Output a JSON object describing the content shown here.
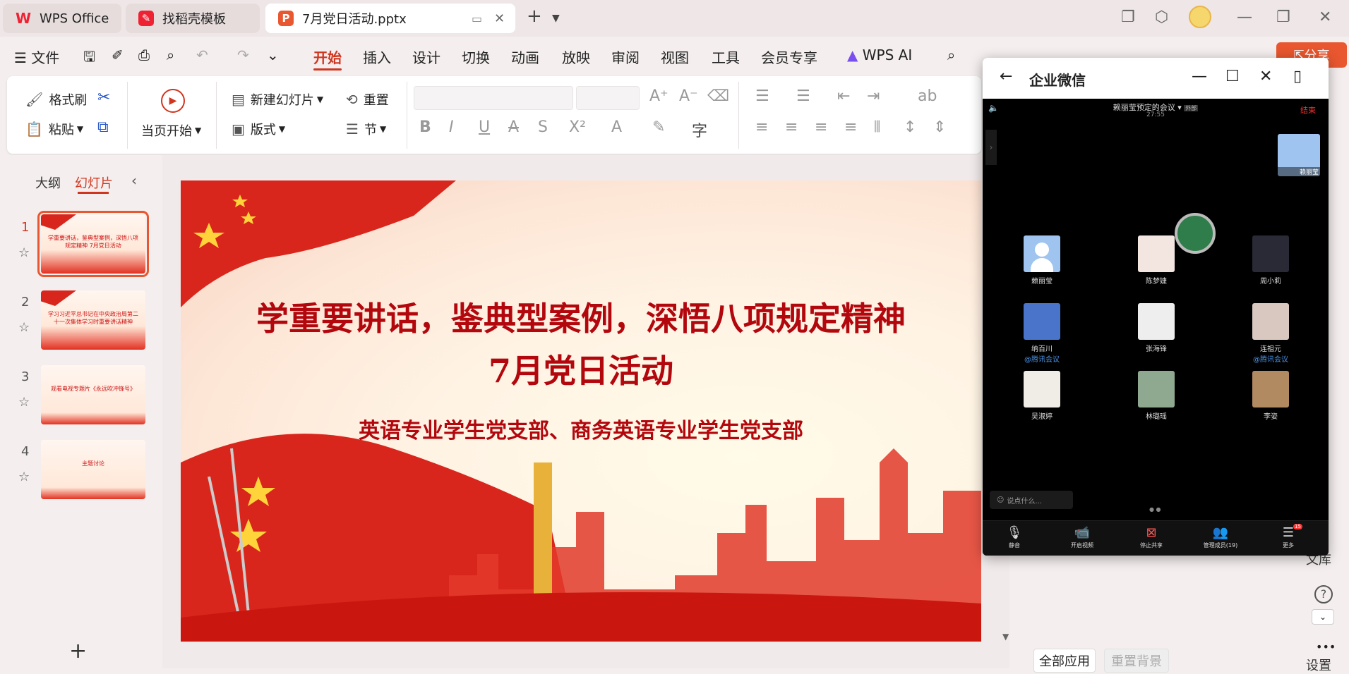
{
  "tabs": [
    {
      "label": "WPS Office",
      "icon": "wps-logo-icon"
    },
    {
      "label": "找稻壳模板",
      "icon": "docer-icon"
    },
    {
      "label": "7月党日活动.pptx",
      "icon": "ppt-file-icon"
    }
  ],
  "menu": {
    "file": "文件",
    "items": [
      "开始",
      "插入",
      "设计",
      "切换",
      "动画",
      "放映",
      "审阅",
      "视图",
      "工具",
      "会员专享"
    ],
    "wps_ai": "WPS AI",
    "share": "分享"
  },
  "ribbon": {
    "format_painter": "格式刷",
    "paste": "粘贴",
    "start_current": "当页开始",
    "new_slide": "新建幻灯片",
    "layout": "版式",
    "reset": "重置",
    "section": "节"
  },
  "sidebar": {
    "tab_outline": "大纲",
    "tab_slides": "幻灯片",
    "slides": [
      {
        "num": "1",
        "text": "学重要讲话，鉴典型案例，深悟八项规定精神 7月党日活动"
      },
      {
        "num": "2",
        "text": "学习习近平总书记在中央政治局第二十一次集体学习时重要讲话精神"
      },
      {
        "num": "3",
        "text": "观看电视专题片《永远吹冲锋号》"
      },
      {
        "num": "4",
        "text": "主题讨论"
      }
    ]
  },
  "slide": {
    "title_line1": "学重要讲话，鉴典型案例，深悟八项规定精神",
    "title_line2": "7月党日活动",
    "subtitle": "英语专业学生党支部、商务英语专业学生党支部"
  },
  "right_panel": {
    "all_apply": "全部应用",
    "reset_bg": "重置背景",
    "strip_labels": [
      "文库",
      "设置"
    ]
  },
  "wework": {
    "title": "企业微信",
    "meeting_title": "赖丽莹预定的会议",
    "meeting_tag": "外部",
    "meeting_time": "27:55",
    "end": "结束",
    "host_name": "赖丽莹",
    "participants": [
      {
        "name": "赖丽莹",
        "tag": ""
      },
      {
        "name": "陈梦婕",
        "tag": ""
      },
      {
        "name": "周小莉",
        "tag": ""
      },
      {
        "name": "纳百川",
        "tag": "@腾讯会议"
      },
      {
        "name": "张海锋",
        "tag": ""
      },
      {
        "name": "连祖元",
        "tag": "@腾讯会议"
      },
      {
        "name": "吴淑婷",
        "tag": ""
      },
      {
        "name": "林璐瑶",
        "tag": ""
      },
      {
        "name": "李姿",
        "tag": ""
      }
    ],
    "chat_placeholder": "说点什么...",
    "controls": [
      "静音",
      "开启视频",
      "停止共享",
      "管理成员(19)",
      "更多"
    ],
    "more_badge": "15"
  },
  "colors": {
    "accent": "#d0361f",
    "slide_red": "#b3070e"
  }
}
